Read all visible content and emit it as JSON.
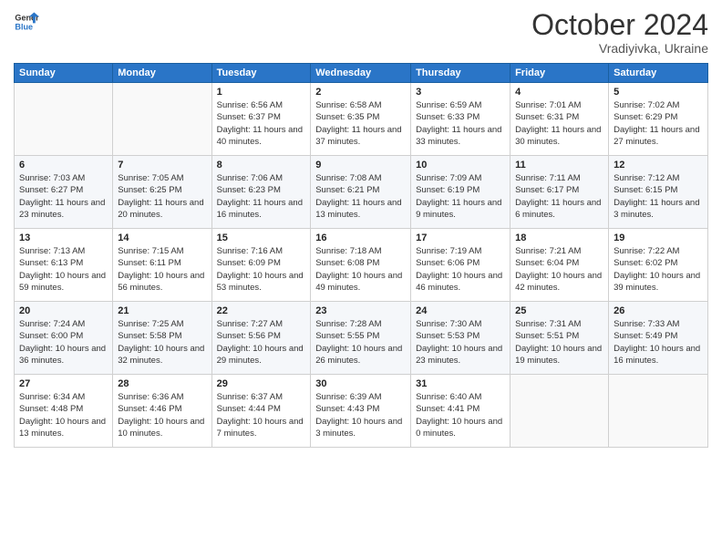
{
  "logo": {
    "line1": "General",
    "line2": "Blue"
  },
  "title": "October 2024",
  "location": "Vradiyivka, Ukraine",
  "days_header": [
    "Sunday",
    "Monday",
    "Tuesday",
    "Wednesday",
    "Thursday",
    "Friday",
    "Saturday"
  ],
  "weeks": [
    [
      {
        "day": "",
        "info": ""
      },
      {
        "day": "",
        "info": ""
      },
      {
        "day": "1",
        "info": "Sunrise: 6:56 AM\nSunset: 6:37 PM\nDaylight: 11 hours and 40 minutes."
      },
      {
        "day": "2",
        "info": "Sunrise: 6:58 AM\nSunset: 6:35 PM\nDaylight: 11 hours and 37 minutes."
      },
      {
        "day": "3",
        "info": "Sunrise: 6:59 AM\nSunset: 6:33 PM\nDaylight: 11 hours and 33 minutes."
      },
      {
        "day": "4",
        "info": "Sunrise: 7:01 AM\nSunset: 6:31 PM\nDaylight: 11 hours and 30 minutes."
      },
      {
        "day": "5",
        "info": "Sunrise: 7:02 AM\nSunset: 6:29 PM\nDaylight: 11 hours and 27 minutes."
      }
    ],
    [
      {
        "day": "6",
        "info": "Sunrise: 7:03 AM\nSunset: 6:27 PM\nDaylight: 11 hours and 23 minutes."
      },
      {
        "day": "7",
        "info": "Sunrise: 7:05 AM\nSunset: 6:25 PM\nDaylight: 11 hours and 20 minutes."
      },
      {
        "day": "8",
        "info": "Sunrise: 7:06 AM\nSunset: 6:23 PM\nDaylight: 11 hours and 16 minutes."
      },
      {
        "day": "9",
        "info": "Sunrise: 7:08 AM\nSunset: 6:21 PM\nDaylight: 11 hours and 13 minutes."
      },
      {
        "day": "10",
        "info": "Sunrise: 7:09 AM\nSunset: 6:19 PM\nDaylight: 11 hours and 9 minutes."
      },
      {
        "day": "11",
        "info": "Sunrise: 7:11 AM\nSunset: 6:17 PM\nDaylight: 11 hours and 6 minutes."
      },
      {
        "day": "12",
        "info": "Sunrise: 7:12 AM\nSunset: 6:15 PM\nDaylight: 11 hours and 3 minutes."
      }
    ],
    [
      {
        "day": "13",
        "info": "Sunrise: 7:13 AM\nSunset: 6:13 PM\nDaylight: 10 hours and 59 minutes."
      },
      {
        "day": "14",
        "info": "Sunrise: 7:15 AM\nSunset: 6:11 PM\nDaylight: 10 hours and 56 minutes."
      },
      {
        "day": "15",
        "info": "Sunrise: 7:16 AM\nSunset: 6:09 PM\nDaylight: 10 hours and 53 minutes."
      },
      {
        "day": "16",
        "info": "Sunrise: 7:18 AM\nSunset: 6:08 PM\nDaylight: 10 hours and 49 minutes."
      },
      {
        "day": "17",
        "info": "Sunrise: 7:19 AM\nSunset: 6:06 PM\nDaylight: 10 hours and 46 minutes."
      },
      {
        "day": "18",
        "info": "Sunrise: 7:21 AM\nSunset: 6:04 PM\nDaylight: 10 hours and 42 minutes."
      },
      {
        "day": "19",
        "info": "Sunrise: 7:22 AM\nSunset: 6:02 PM\nDaylight: 10 hours and 39 minutes."
      }
    ],
    [
      {
        "day": "20",
        "info": "Sunrise: 7:24 AM\nSunset: 6:00 PM\nDaylight: 10 hours and 36 minutes."
      },
      {
        "day": "21",
        "info": "Sunrise: 7:25 AM\nSunset: 5:58 PM\nDaylight: 10 hours and 32 minutes."
      },
      {
        "day": "22",
        "info": "Sunrise: 7:27 AM\nSunset: 5:56 PM\nDaylight: 10 hours and 29 minutes."
      },
      {
        "day": "23",
        "info": "Sunrise: 7:28 AM\nSunset: 5:55 PM\nDaylight: 10 hours and 26 minutes."
      },
      {
        "day": "24",
        "info": "Sunrise: 7:30 AM\nSunset: 5:53 PM\nDaylight: 10 hours and 23 minutes."
      },
      {
        "day": "25",
        "info": "Sunrise: 7:31 AM\nSunset: 5:51 PM\nDaylight: 10 hours and 19 minutes."
      },
      {
        "day": "26",
        "info": "Sunrise: 7:33 AM\nSunset: 5:49 PM\nDaylight: 10 hours and 16 minutes."
      }
    ],
    [
      {
        "day": "27",
        "info": "Sunrise: 6:34 AM\nSunset: 4:48 PM\nDaylight: 10 hours and 13 minutes."
      },
      {
        "day": "28",
        "info": "Sunrise: 6:36 AM\nSunset: 4:46 PM\nDaylight: 10 hours and 10 minutes."
      },
      {
        "day": "29",
        "info": "Sunrise: 6:37 AM\nSunset: 4:44 PM\nDaylight: 10 hours and 7 minutes."
      },
      {
        "day": "30",
        "info": "Sunrise: 6:39 AM\nSunset: 4:43 PM\nDaylight: 10 hours and 3 minutes."
      },
      {
        "day": "31",
        "info": "Sunrise: 6:40 AM\nSunset: 4:41 PM\nDaylight: 10 hours and 0 minutes."
      },
      {
        "day": "",
        "info": ""
      },
      {
        "day": "",
        "info": ""
      }
    ]
  ]
}
